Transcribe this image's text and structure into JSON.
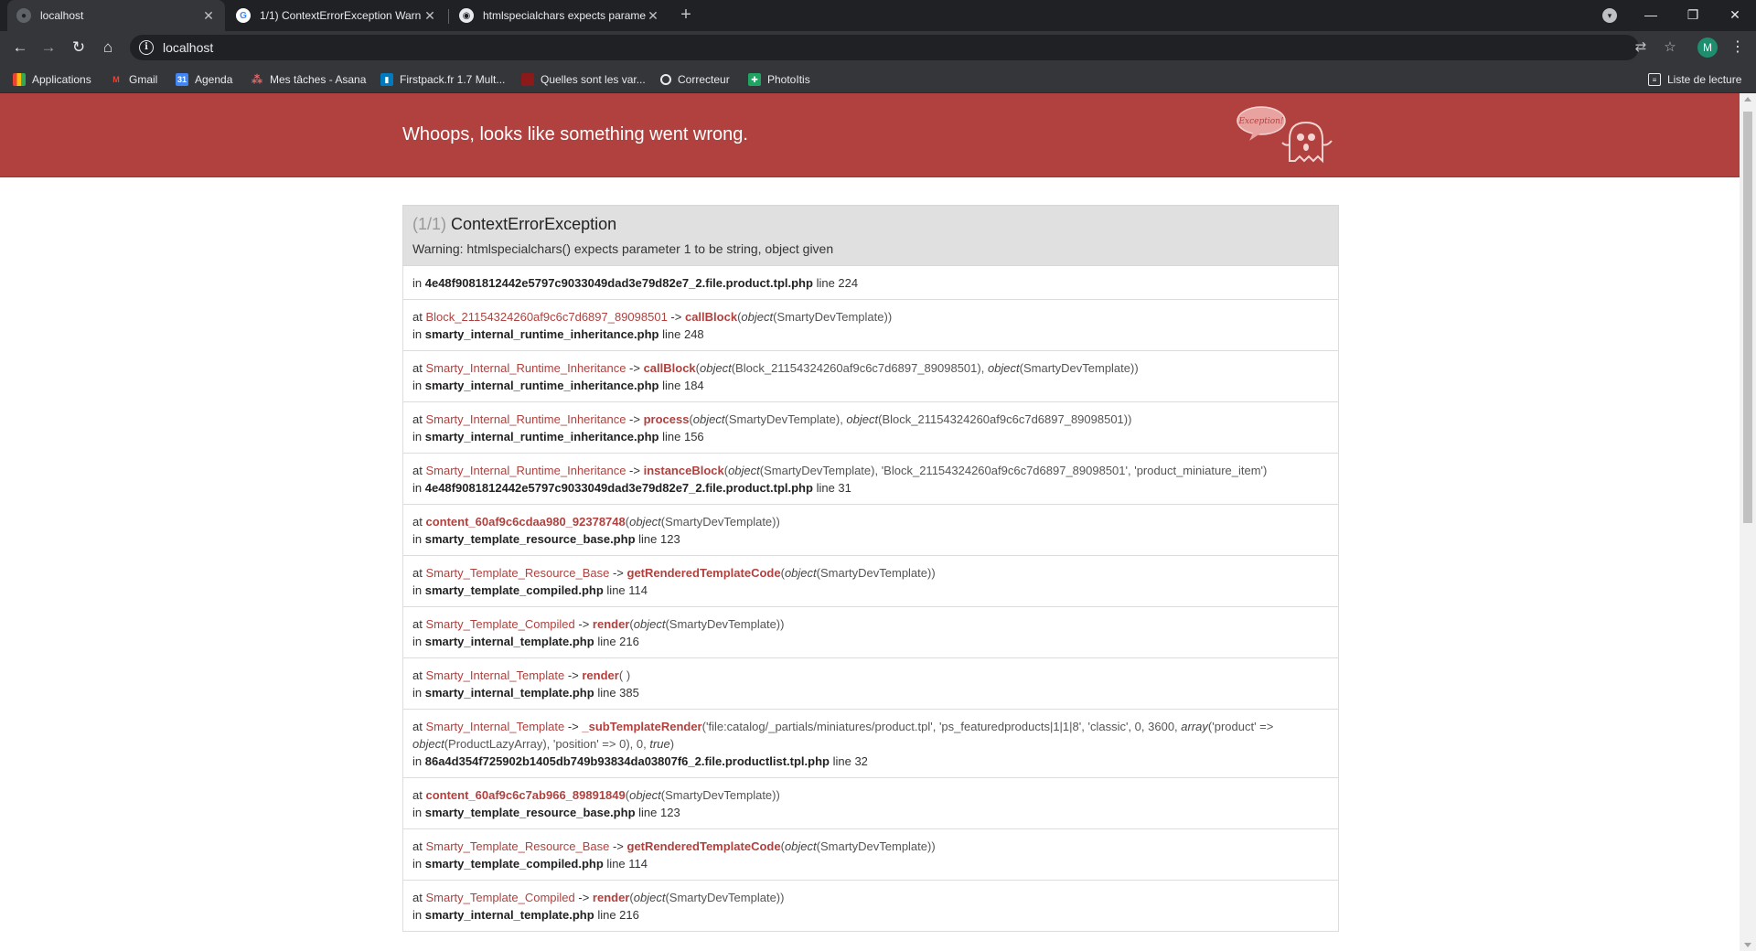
{
  "browser": {
    "tabs": [
      {
        "title": "localhost",
        "active": true
      },
      {
        "title": "1/1) ContextErrorException Warn",
        "active": false
      },
      {
        "title": "htmlspecialchars expects parame",
        "active": false
      }
    ],
    "address": "localhost",
    "bookmarks": [
      {
        "label": "Applications",
        "icon": "apps-grid-icon"
      },
      {
        "label": "Gmail",
        "icon": "gmail-icon"
      },
      {
        "label": "Agenda",
        "icon": "calendar-icon"
      },
      {
        "label": "Mes tâches - Asana",
        "icon": "asana-icon"
      },
      {
        "label": "Firstpack.fr 1.7 Mult...",
        "icon": "trello-icon"
      },
      {
        "label": "Quelles sont les var...",
        "icon": "bookmark-icon"
      },
      {
        "label": "Correcteur",
        "icon": "correcteur-icon"
      },
      {
        "label": "PhotoItis",
        "icon": "photoitis-icon"
      }
    ],
    "reading_list": "Liste de lecture",
    "avatar_letter": "M"
  },
  "page": {
    "banner_title": "Whoops, looks like something went wrong.",
    "ghost_label": "Exception!",
    "exception": {
      "count": "(1/1)",
      "name": "ContextErrorException",
      "message": "Warning: htmlspecialchars() expects parameter 1 to be string, object given"
    },
    "trace": [
      {
        "at": null,
        "file": "4e48f9081812442e5797c9033049dad3e79d82e7_2.file.product.tpl.php",
        "line": "line 224"
      },
      {
        "at": {
          "cls": "Block_21154324260af9c6c7d6897_89098501",
          "arrow": "->",
          "fn": "callBlock",
          "args": [
            [
              "i",
              "object"
            ],
            [
              "t",
              "(SmartyDevTemplate)"
            ]
          ]
        },
        "file": "smarty_internal_runtime_inheritance.php",
        "line": "line 248"
      },
      {
        "at": {
          "cls": "Smarty_Internal_Runtime_Inheritance",
          "arrow": "->",
          "fn": "callBlock",
          "args": [
            [
              "i",
              "object"
            ],
            [
              "t",
              "(Block_21154324260af9c6c7d6897_89098501), "
            ],
            [
              "i",
              "object"
            ],
            [
              "t",
              "(SmartyDevTemplate)"
            ]
          ]
        },
        "file": "smarty_internal_runtime_inheritance.php",
        "line": "line 184"
      },
      {
        "at": {
          "cls": "Smarty_Internal_Runtime_Inheritance",
          "arrow": "->",
          "fn": "process",
          "args": [
            [
              "i",
              "object"
            ],
            [
              "t",
              "(SmartyDevTemplate), "
            ],
            [
              "i",
              "object"
            ],
            [
              "t",
              "(Block_21154324260af9c6c7d6897_89098501)"
            ]
          ]
        },
        "file": "smarty_internal_runtime_inheritance.php",
        "line": "line 156"
      },
      {
        "at": {
          "cls": "Smarty_Internal_Runtime_Inheritance",
          "arrow": "->",
          "fn": "instanceBlock",
          "args": [
            [
              "i",
              "object"
            ],
            [
              "t",
              "(SmartyDevTemplate), 'Block_21154324260af9c6c7d6897_89098501', 'product_miniature_item'"
            ]
          ]
        },
        "file": "4e48f9081812442e5797c9033049dad3e79d82e7_2.file.product.tpl.php",
        "line": "line 31"
      },
      {
        "at": {
          "cls": "",
          "arrow": "",
          "fn": " content_60af9c6cdaa980_92378748",
          "args": [
            [
              "i",
              "object"
            ],
            [
              "t",
              "(SmartyDevTemplate)"
            ]
          ]
        },
        "file": "smarty_template_resource_base.php",
        "line": "line 123"
      },
      {
        "at": {
          "cls": "Smarty_Template_Resource_Base",
          "arrow": "->",
          "fn": "getRenderedTemplateCode",
          "args": [
            [
              "i",
              "object"
            ],
            [
              "t",
              "(SmartyDevTemplate)"
            ]
          ]
        },
        "file": "smarty_template_compiled.php",
        "line": "line 114"
      },
      {
        "at": {
          "cls": "Smarty_Template_Compiled",
          "arrow": "->",
          "fn": "render",
          "args": [
            [
              "i",
              "object"
            ],
            [
              "t",
              "(SmartyDevTemplate)"
            ]
          ]
        },
        "file": "smarty_internal_template.php",
        "line": "line 216"
      },
      {
        "at": {
          "cls": "Smarty_Internal_Template",
          "arrow": "->",
          "fn": "render",
          "args": [
            [
              "t",
              " "
            ]
          ]
        },
        "file": "smarty_internal_template.php",
        "line": "line 385"
      },
      {
        "at": {
          "cls": "Smarty_Internal_Template",
          "arrow": "->",
          "fn": "_subTemplateRender",
          "args": [
            [
              "t",
              "'file:catalog/_partials/miniatures/product.tpl', 'ps_featuredproducts|1|1|8', 'classic', 0, 3600, "
            ],
            [
              "i",
              "array"
            ],
            [
              "t",
              "('product' => "
            ],
            [
              "i",
              "object"
            ],
            [
              "t",
              "(ProductLazyArray), 'position' => 0), 0, "
            ],
            [
              "i",
              "true"
            ]
          ]
        },
        "file": "86a4d354f725902b1405db749b93834da03807f6_2.file.productlist.tpl.php",
        "line": "line 32"
      },
      {
        "at": {
          "cls": "",
          "arrow": "",
          "fn": " content_60af9c6c7ab966_89891849",
          "args": [
            [
              "i",
              "object"
            ],
            [
              "t",
              "(SmartyDevTemplate)"
            ]
          ]
        },
        "file": "smarty_template_resource_base.php",
        "line": "line 123"
      },
      {
        "at": {
          "cls": "Smarty_Template_Resource_Base",
          "arrow": "->",
          "fn": "getRenderedTemplateCode",
          "args": [
            [
              "i",
              "object"
            ],
            [
              "t",
              "(SmartyDevTemplate)"
            ]
          ]
        },
        "file": "smarty_template_compiled.php",
        "line": "line 114"
      },
      {
        "at": {
          "cls": "Smarty_Template_Compiled",
          "arrow": "->",
          "fn": "render",
          "args": [
            [
              "i",
              "object"
            ],
            [
              "t",
              "(SmartyDevTemplate)"
            ]
          ]
        },
        "file": "smarty_internal_template.php",
        "line": "line 216"
      }
    ]
  },
  "colors": {
    "banner": "#b0413e",
    "link": "#b0413e",
    "chrome_dark": "#202124",
    "chrome_toolbar": "#35363a"
  }
}
